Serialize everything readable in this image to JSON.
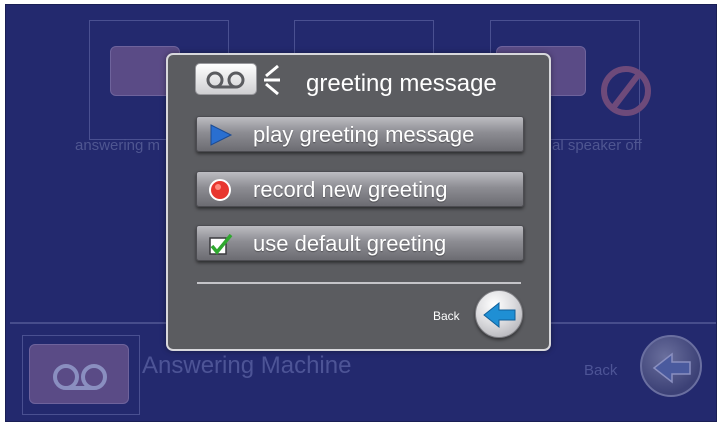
{
  "dialog": {
    "title": "greeting message",
    "title_icon": "voicemail-icon",
    "options": [
      {
        "label": "play greeting message",
        "icon": "play-icon"
      },
      {
        "label": "record new greeting",
        "icon": "record-icon"
      },
      {
        "label": "use default greeting",
        "icon": "checkbox-checked-icon"
      }
    ],
    "back_label": "Back",
    "back_icon": "arrow-left-icon"
  },
  "background": {
    "tile_left_label": "answering m",
    "tile_right_label": "al speaker off",
    "title": "Answering Machine",
    "back_label": "Back",
    "title_icon": "voicemail-icon"
  },
  "colors": {
    "screen_bg": "#23296e",
    "dialog_bg": "#5b5c60",
    "accent_blue": "#1f8fd4",
    "record_red": "#e8362f",
    "check_green": "#2fa82f"
  }
}
